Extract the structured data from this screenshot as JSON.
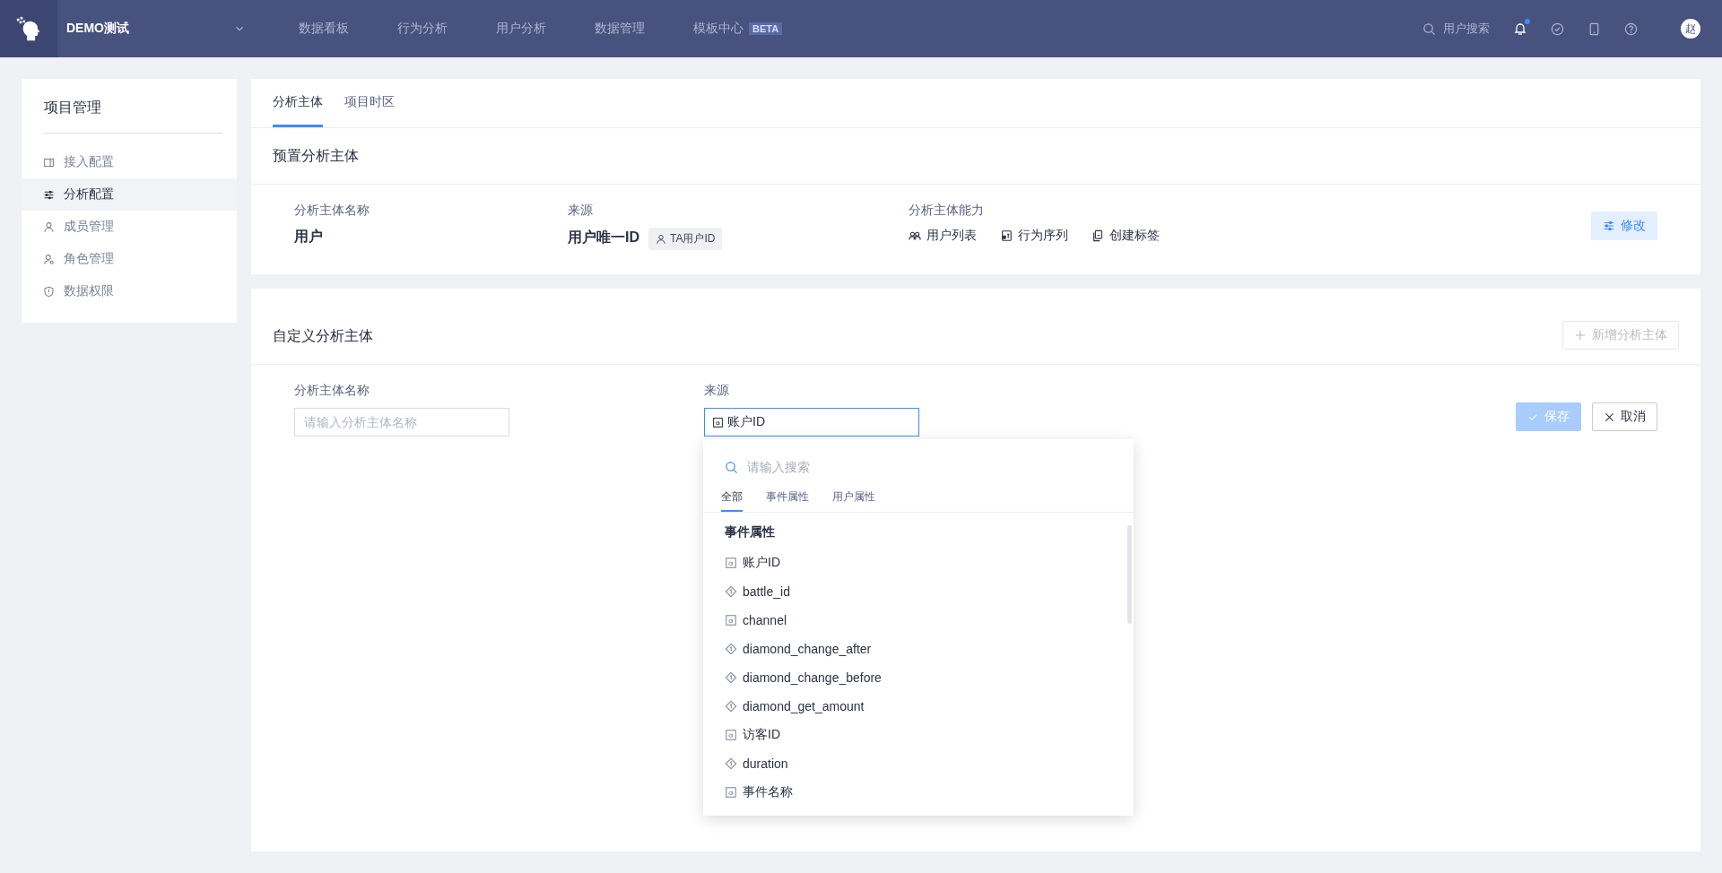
{
  "topbar": {
    "project": "DEMO测试",
    "nav": [
      {
        "label": "数据看板"
      },
      {
        "label": "行为分析"
      },
      {
        "label": "用户分析"
      },
      {
        "label": "数据管理"
      },
      {
        "label": "模板中心",
        "badge": "BETA"
      }
    ],
    "search": {
      "placeholder": "用户搜索"
    },
    "notifications": {
      "unread": true
    },
    "avatar": "赵"
  },
  "sidebar": {
    "title": "项目管理",
    "items": [
      {
        "label": "接入配置",
        "selected": false
      },
      {
        "label": "分析配置",
        "selected": true
      },
      {
        "label": "成员管理",
        "selected": false
      },
      {
        "label": "角色管理",
        "selected": false
      },
      {
        "label": "数据权限",
        "selected": false
      }
    ]
  },
  "tabs": [
    {
      "label": "分析主体",
      "selected": true
    },
    {
      "label": "项目时区",
      "selected": false
    }
  ],
  "preset": {
    "title": "预置分析主体",
    "name_label": "分析主体名称",
    "name": "用户",
    "source_label": "来源",
    "source": "用户唯一ID",
    "source_tag": "TA用户ID",
    "abilities_label": "分析主体能力",
    "abilities": [
      {
        "label": "用户列表"
      },
      {
        "label": "行为序列"
      },
      {
        "label": "创建标签"
      }
    ],
    "edit_button": "修改"
  },
  "custom": {
    "title": "自定义分析主体",
    "add_button": {
      "label": "新增分析主体",
      "disabled": true
    },
    "name_label": "分析主体名称",
    "name_field": {
      "placeholder": "请输入分析主体名称"
    },
    "source_label": "来源",
    "source_field": {
      "value": "账户ID",
      "focused": true
    },
    "save_button": {
      "label": "保存",
      "disabled": true
    },
    "cancel_button": "取消"
  },
  "dropdown": {
    "search": {
      "placeholder": "请输入搜索"
    },
    "tabs": [
      {
        "label": "全部",
        "selected": true
      },
      {
        "label": "事件属性",
        "selected": false
      },
      {
        "label": "用户属性",
        "selected": false
      }
    ],
    "group": "事件属性",
    "items": [
      {
        "label": "账户ID",
        "kind": "string"
      },
      {
        "label": "battle_id",
        "kind": "number"
      },
      {
        "label": "channel",
        "kind": "string"
      },
      {
        "label": "diamond_change_after",
        "kind": "number"
      },
      {
        "label": "diamond_change_before",
        "kind": "number"
      },
      {
        "label": "diamond_get_amount",
        "kind": "number"
      },
      {
        "label": "访客ID",
        "kind": "string"
      },
      {
        "label": "duration",
        "kind": "number"
      },
      {
        "label": "事件名称",
        "kind": "string"
      }
    ]
  }
}
